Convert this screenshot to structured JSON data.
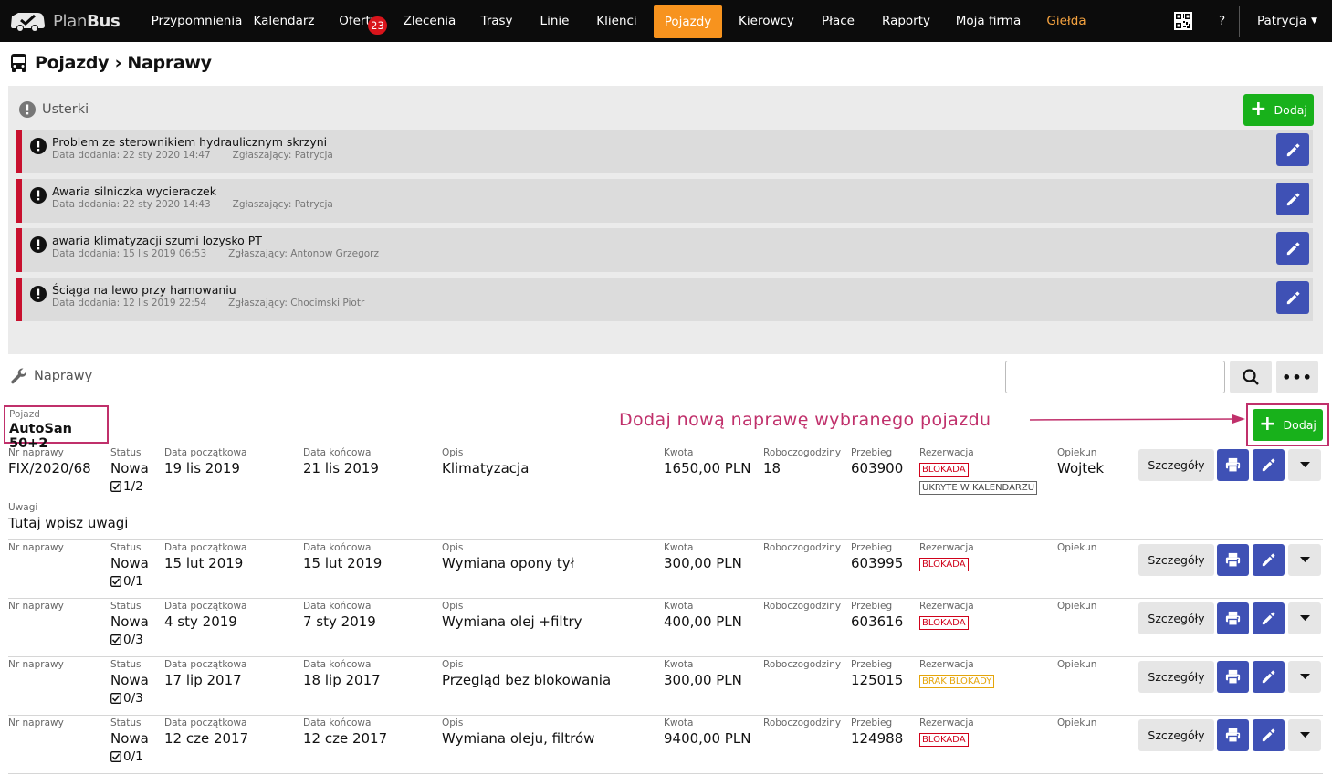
{
  "app": {
    "brand_light": "Plan",
    "brand_bold": "Bus"
  },
  "nav": {
    "items": [
      {
        "label": "Przypomnienia"
      },
      {
        "label": "Kalendarz"
      },
      {
        "label": "Oferty",
        "badge": "23"
      },
      {
        "label": "Zlecenia"
      },
      {
        "label": "Trasy"
      },
      {
        "label": "Linie"
      },
      {
        "label": "Klienci"
      },
      {
        "label": "Pojazdy",
        "active": true
      },
      {
        "label": "Kierowcy"
      },
      {
        "label": "Płace"
      },
      {
        "label": "Raporty"
      },
      {
        "label": "Moja firma"
      },
      {
        "label": "Giełda"
      }
    ],
    "help": "?",
    "user": "Patrycja",
    "icons": {
      "qr": "qr-code-icon",
      "caret": "caret-down-icon"
    }
  },
  "page": {
    "title": "Pojazdy › Naprawy"
  },
  "usterki": {
    "title": "Usterki",
    "add_label": "Dodaj",
    "items": [
      {
        "title": "Problem ze sterownikiem hydraulicznym skrzyni",
        "date": "Data dodania: 22 sty 2020 14:47",
        "reporter": "Zgłaszający: Patrycja"
      },
      {
        "title": "Awaria silniczka wycieraczek",
        "date": "Data dodania: 22 sty 2020 14:43",
        "reporter": "Zgłaszający: Patrycja"
      },
      {
        "title": "awaria klimatyzacji szumi lozysko PT",
        "date": "Data dodania: 15 lis 2019 06:53",
        "reporter": "Zgłaszający: Antonow Grzegorz"
      },
      {
        "title": "Ściąga na lewo przy hamowaniu",
        "date": "Data dodania: 12 lis 2019 22:54",
        "reporter": "Zgłaszający: Chocimski Piotr"
      }
    ]
  },
  "naprawy": {
    "title": "Naprawy",
    "search": {
      "value": "",
      "placeholder": ""
    },
    "vehicle": {
      "label": "Pojazd",
      "value": "AutoSan 50+2"
    },
    "annotation": "Dodaj nową naprawę wybranego pojazdu",
    "add_label": "Dodaj",
    "details_label": "Szczegóły",
    "labels": {
      "nr": "Nr naprawy",
      "status": "Status",
      "start": "Data początkowa",
      "end": "Data końcowa",
      "opis": "Opis",
      "kwota": "Kwota",
      "hours": "Roboczogodziny",
      "przebieg": "Przebieg",
      "rezerwacja": "Rezerwacja",
      "opiekun": "Opiekun",
      "uwagi": "Uwagi"
    },
    "rows": [
      {
        "nr": "FIX/2020/68",
        "status": "Nowa",
        "check": "1/2",
        "start": "19 lis 2019",
        "end": "21 lis 2019",
        "opis": "Klimatyzacja",
        "kwota": "1650,00 PLN",
        "hours": "18",
        "przebieg": "603900",
        "tags": [
          {
            "text": "BLOKADA",
            "kind": "red"
          },
          {
            "text": "UKRYTE W KALENDARZU",
            "kind": "dark"
          }
        ],
        "opiekun": "Wojtek",
        "uwagi": "Tutaj wpisz uwagi"
      },
      {
        "nr": "",
        "status": "Nowa",
        "check": "0/1",
        "start": "15 lut 2019",
        "end": "15 lut 2019",
        "opis": "Wymiana opony tył",
        "kwota": "300,00 PLN",
        "hours": "",
        "przebieg": "603995",
        "tags": [
          {
            "text": "BLOKADA",
            "kind": "red"
          }
        ],
        "opiekun": ""
      },
      {
        "nr": "",
        "status": "Nowa",
        "check": "0/3",
        "start": "4 sty 2019",
        "end": "7 sty 2019",
        "opis": "Wymiana olej +filtry",
        "kwota": "400,00 PLN",
        "hours": "",
        "przebieg": "603616",
        "tags": [
          {
            "text": "BLOKADA",
            "kind": "red"
          }
        ],
        "opiekun": ""
      },
      {
        "nr": "",
        "status": "Nowa",
        "check": "0/3",
        "start": "17 lip 2017",
        "end": "18 lip 2017",
        "opis": "Przegląd bez blokowania",
        "kwota": "300,00 PLN",
        "hours": "",
        "przebieg": "125015",
        "tags": [
          {
            "text": "BRAK BLOKADY",
            "kind": "yellow"
          }
        ],
        "opiekun": ""
      },
      {
        "nr": "",
        "status": "Nowa",
        "check": "0/1",
        "start": "12 cze 2017",
        "end": "12 cze 2017",
        "opis": "Wymiana oleju, filtrów",
        "kwota": "9400,00 PLN",
        "hours": "",
        "przebieg": "124988",
        "tags": [
          {
            "text": "BLOKADA",
            "kind": "red"
          }
        ],
        "opiekun": ""
      }
    ]
  },
  "colors": {
    "accent": "#f7931e",
    "primary": "#3f51b5",
    "success": "#18b11b",
    "danger": "#c8102e",
    "annotation": "#c0306b"
  }
}
